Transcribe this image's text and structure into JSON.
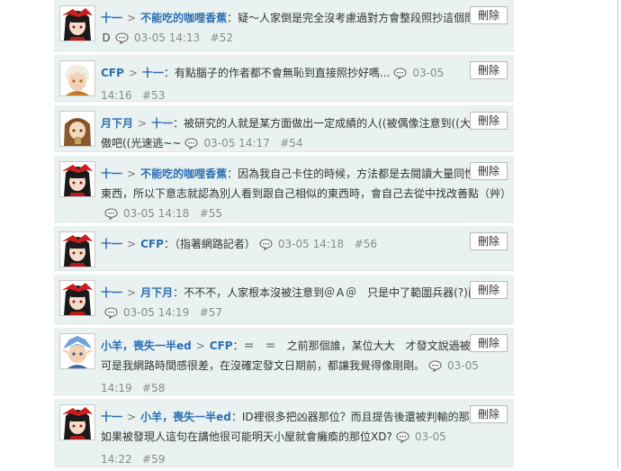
{
  "delete_label": "刪除",
  "comments": [
    {
      "user": "十一",
      "target": "不能吃的咖哩香蕉",
      "text": "疑～人家倒是完全沒考慮過對方會整段照抄這個問題ＸＤ",
      "time": "03-05 14:13",
      "num": "#52",
      "avatar": "black-hair-red-girl"
    },
    {
      "user": "CFP",
      "target": "十一",
      "text": "有點腦子的作者都不會無恥到直接照抄好嗎...",
      "time": "03-05 14:16",
      "num": "#53",
      "avatar": "white-hair-boy"
    },
    {
      "user": "月下月",
      "target": "十一",
      "text": "被研究的人就是某方面做出一定成績的人((被偶像注意到((大方的驕傲吧((光速逃~~",
      "time": "03-05 14:17",
      "num": "#54",
      "avatar": "brown-hair-girl"
    },
    {
      "user": "十一",
      "target": "不能吃的咖哩香蕉",
      "text": "因為我自己卡住的時候，方法都是去閱讀大量同性質的東西，所以下意志就認為別人看到跟自己相似的東西時，會自己去從中找改善點（艸）",
      "time": "03-05 14:18",
      "num": "#55",
      "avatar": "black-hair-red-girl"
    },
    {
      "user": "十一",
      "target": "CFP",
      "text": "（指著網路記者）",
      "time": "03-05 14:18",
      "num": "#56",
      "avatar": "black-hair-red-girl"
    },
    {
      "user": "十一",
      "target": "月下月",
      "text": "不不不，人家根本沒被注意到＠Ａ＠　只是中了範圍兵器(?)而已",
      "time": "03-05 14:19",
      "num": "#57",
      "avatar": "black-hair-red-girl"
    },
    {
      "user": "小羊，喪失一半ed",
      "target": "CFP",
      "text": "＝　＝　之前那個誰，某位大大　才發文說過被照抄。　可是我網路時間感很差，在沒確定發文日期前，都讓我覺得像剛剛。",
      "time": "03-05 14:19",
      "num": "#58",
      "avatar": "blue-hair-elf"
    },
    {
      "user": "十一",
      "target": "小羊，喪失一半ed",
      "text": "ID裡很多把凶器那位？而且提告後還被判輸的那位XD? 如果被發現人這句在講他很可能明天小屋就會癱瘓的那位XD?",
      "time": "03-05 14:22",
      "num": "#59",
      "avatar": "black-hair-red-girl"
    }
  ]
}
